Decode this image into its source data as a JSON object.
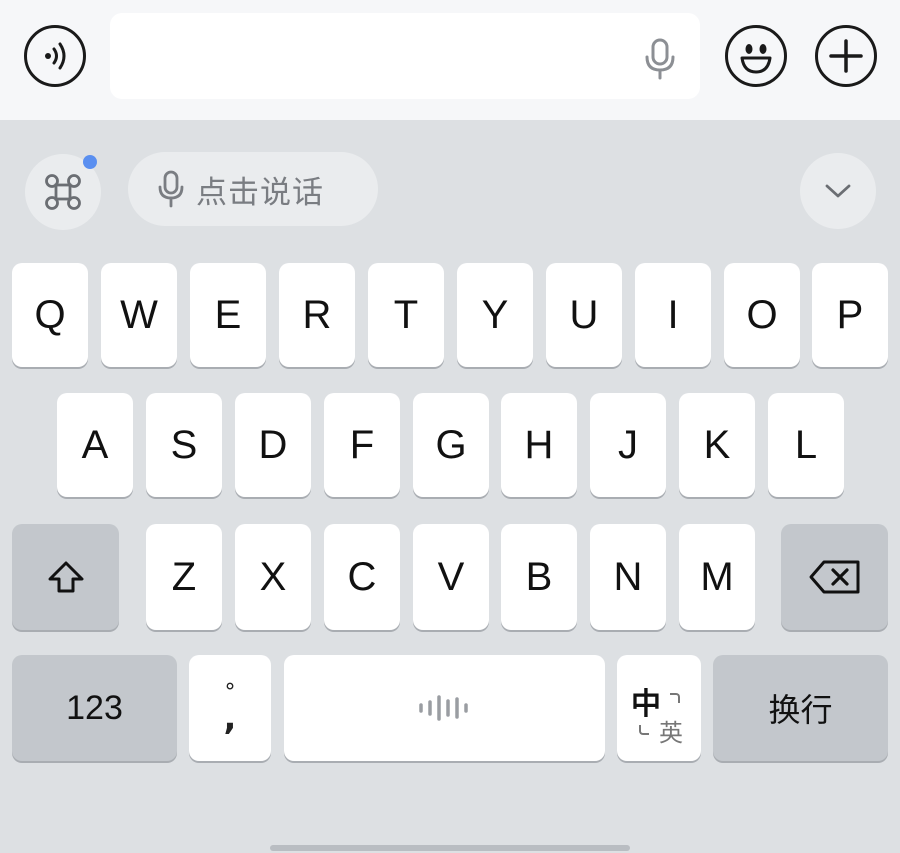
{
  "input": {
    "placeholder": "",
    "value": ""
  },
  "toolbar": {
    "speak_label": "点击说话"
  },
  "rows": {
    "row1": [
      "Q",
      "W",
      "E",
      "R",
      "T",
      "Y",
      "U",
      "I",
      "O",
      "P"
    ],
    "row2": [
      "A",
      "S",
      "D",
      "F",
      "G",
      "H",
      "J",
      "K",
      "L"
    ],
    "row3": [
      "Z",
      "X",
      "C",
      "V",
      "B",
      "N",
      "M"
    ]
  },
  "bottom": {
    "num_label": "123",
    "punct_top": "°",
    "punct_bottom": ",",
    "lang_zh": "中",
    "lang_en": "英",
    "enter_label": "换行"
  },
  "icons": {
    "voice": "speaker-icon",
    "mic": "microphone-icon",
    "emoji": "smiley-icon",
    "plus": "plus-icon",
    "grid": "command-grid-icon",
    "collapse": "chevron-down-icon",
    "shift": "shift-arrow-icon",
    "backspace": "backspace-icon",
    "space": "waveform-icon"
  },
  "colors": {
    "notification_dot": "#5a8ff0",
    "keyboard_bg": "#dde0e3",
    "key_bg": "#ffffff",
    "func_key_bg": "#c3c7cc"
  }
}
